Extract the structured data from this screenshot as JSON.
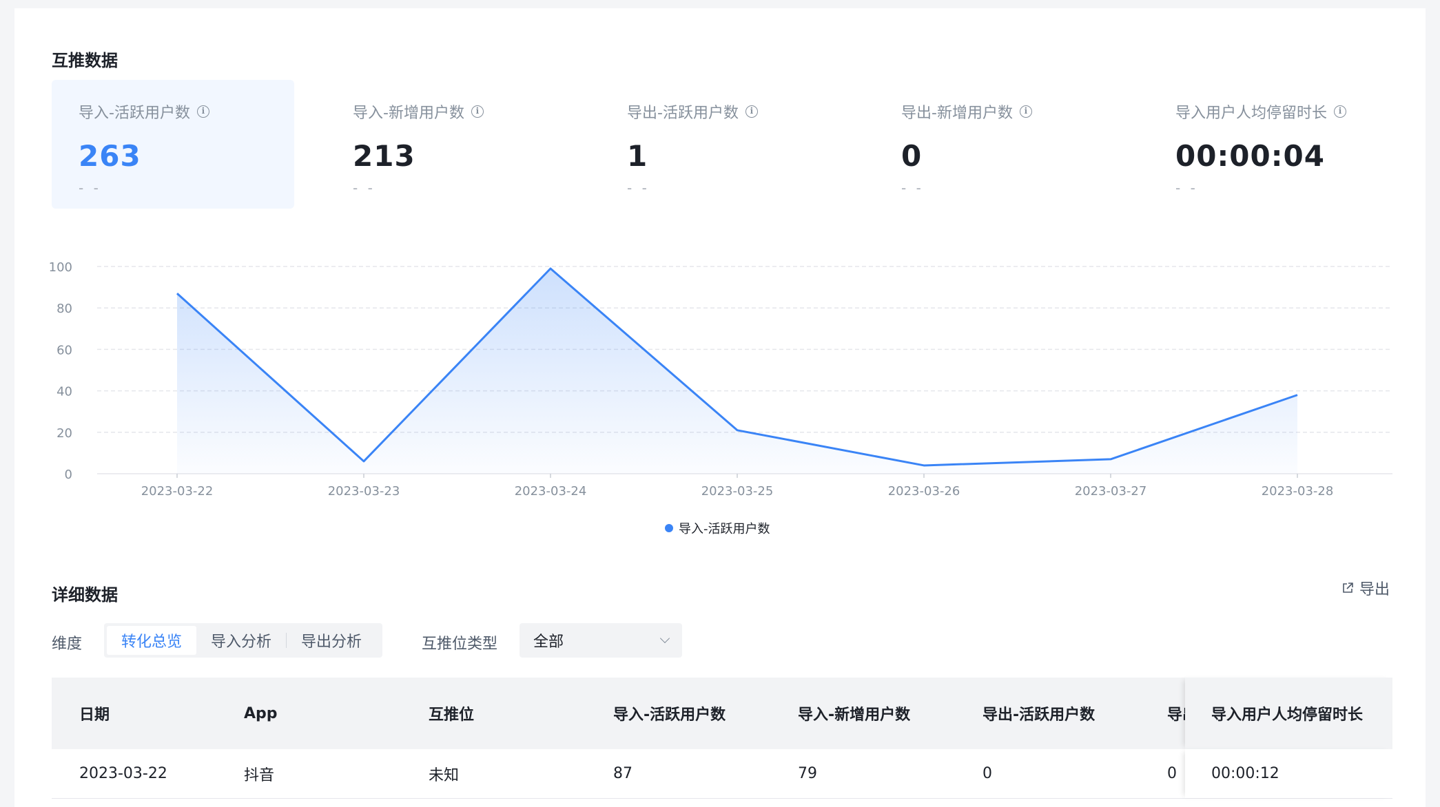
{
  "section1_title": "互推数据",
  "metrics": [
    {
      "label": "导入-活跃用户数",
      "value": "263",
      "trend": "- -",
      "active": true
    },
    {
      "label": "导入-新增用户数",
      "value": "213",
      "trend": "- -"
    },
    {
      "label": "导出-活跃用户数",
      "value": "1",
      "trend": "- -"
    },
    {
      "label": "导出-新增用户数",
      "value": "0",
      "trend": "- -"
    },
    {
      "label": "导入用户人均停留时长",
      "value": "00:00:04",
      "trend": "- -"
    }
  ],
  "chart_data": {
    "type": "area",
    "x": [
      "2023-03-22",
      "2023-03-23",
      "2023-03-24",
      "2023-03-25",
      "2023-03-26",
      "2023-03-27",
      "2023-03-28"
    ],
    "series": [
      {
        "name": "导入-活跃用户数",
        "values": [
          87,
          6,
          99,
          21,
          4,
          7,
          38
        ]
      }
    ],
    "yticks": [
      0,
      20,
      40,
      60,
      80,
      100
    ],
    "ylim": [
      0,
      100
    ],
    "grid": true,
    "legend": "bottom-center",
    "color": "#3a84f6"
  },
  "section2_title": "详细数据",
  "export_label": "导出",
  "dimension_label": "维度",
  "tabs": [
    "转化总览",
    "导入分析",
    "导出分析"
  ],
  "type_label": "互推位类型",
  "type_select_value": "全部",
  "table": {
    "headers": [
      "日期",
      "App",
      "互推位",
      "导入-活跃用户数",
      "导入-新增用户数",
      "导出-活跃用户数",
      "导出-新增用户数"
    ],
    "fixed_header": "导入用户人均停留时长",
    "rows": [
      {
        "cells": [
          "2023-03-22",
          "抖音",
          "未知",
          "87",
          "79",
          "0",
          "0"
        ],
        "fixed": "00:00:12"
      }
    ]
  }
}
